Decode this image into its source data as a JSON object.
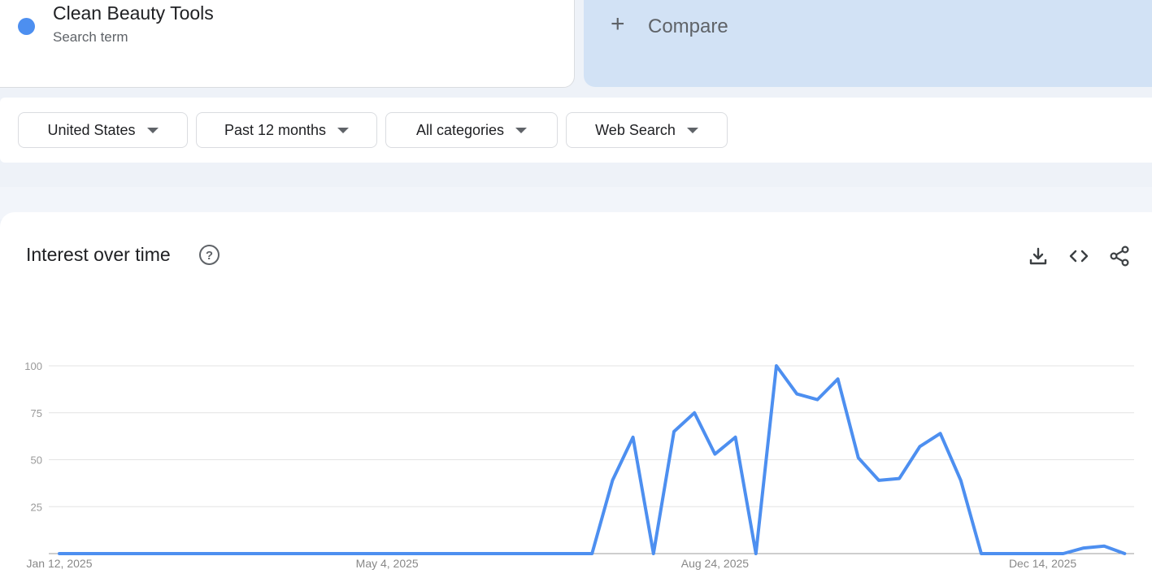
{
  "term": {
    "name": "Clean Beauty Tools",
    "subtitle": "Search term",
    "color": "#4d8ff0"
  },
  "compare": {
    "label": "Compare",
    "icon": "plus-icon"
  },
  "filters": [
    {
      "label": "United States"
    },
    {
      "label": "Past 12 months"
    },
    {
      "label": "All categories"
    },
    {
      "label": "Web Search"
    }
  ],
  "panel": {
    "title": "Interest over time",
    "help_icon": "help-circle-icon",
    "actions": [
      "download-icon",
      "embed-code-icon",
      "share-icon"
    ]
  },
  "chart_data": {
    "type": "line",
    "x_labels": [
      "Jan 12, 2025",
      "May 4, 2025",
      "Aug 24, 2025",
      "Dec 14, 2025"
    ],
    "x_label_weeks": [
      0,
      16,
      32,
      48
    ],
    "yticks": [
      "25",
      "50",
      "75",
      "100"
    ],
    "ylim": [
      0,
      100
    ],
    "grid": true,
    "series": [
      {
        "color": "#4d8ff0",
        "values": [
          0,
          0,
          0,
          0,
          0,
          0,
          0,
          0,
          0,
          0,
          0,
          0,
          0,
          0,
          0,
          0,
          0,
          0,
          0,
          0,
          0,
          0,
          0,
          0,
          0,
          0,
          0,
          39,
          62,
          0,
          65,
          75,
          53,
          62,
          0,
          100,
          85,
          82,
          93,
          51,
          39,
          40,
          57,
          64,
          39,
          0,
          0,
          0,
          0,
          0,
          3,
          4,
          0
        ]
      }
    ]
  }
}
